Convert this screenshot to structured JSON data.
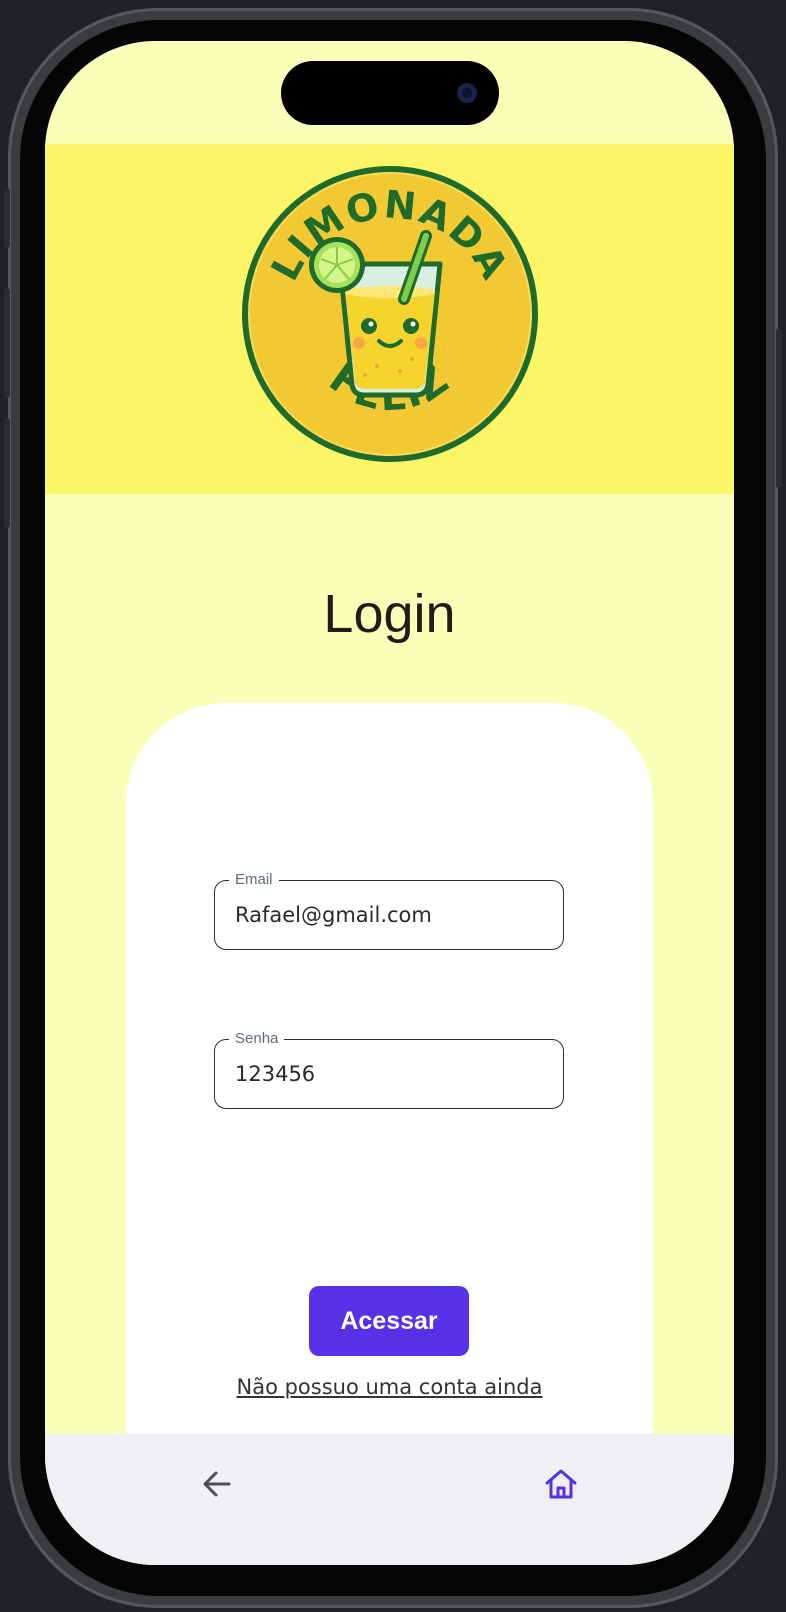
{
  "app": {
    "logo_text_top": "LIMONADA",
    "logo_text_bottom": "FELIZ"
  },
  "login": {
    "title": "Login",
    "email": {
      "label": "Email",
      "value": "Rafael@gmail.com"
    },
    "password": {
      "label": "Senha",
      "value": "123456"
    },
    "submit_label": "Acessar",
    "no_account_link": "Não possuo uma conta ainda"
  },
  "navbar": {
    "back_icon": "arrow-left-icon",
    "home_icon": "home-icon"
  },
  "colors": {
    "background": "#f9ffb7",
    "header": "#fcf566",
    "accent": "#5631e7",
    "logo_green": "#1e6b2b"
  }
}
